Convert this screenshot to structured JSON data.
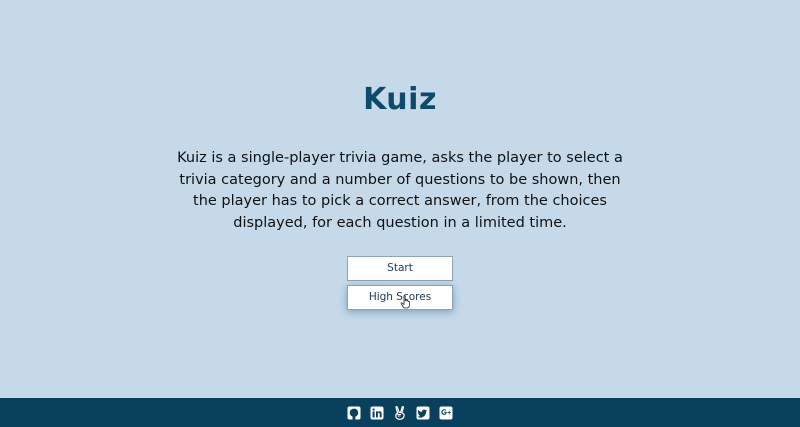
{
  "app": {
    "title": "Kuiz",
    "description": "Kuiz is a single-player trivia game, asks the player to select a trivia category and a number of questions to be shown, then the player has to pick a correct answer, from the choices displayed, for each question in a limited time."
  },
  "buttons": {
    "start_label": "Start",
    "high_scores_label": "High Scores"
  },
  "footer": {
    "icons": [
      "github-icon",
      "linkedin-icon",
      "angellist-icon",
      "twitter-icon",
      "google-plus-icon"
    ]
  },
  "colors": {
    "background": "#c5d9e8",
    "title": "#0d4a6b",
    "footer": "#08405d"
  }
}
